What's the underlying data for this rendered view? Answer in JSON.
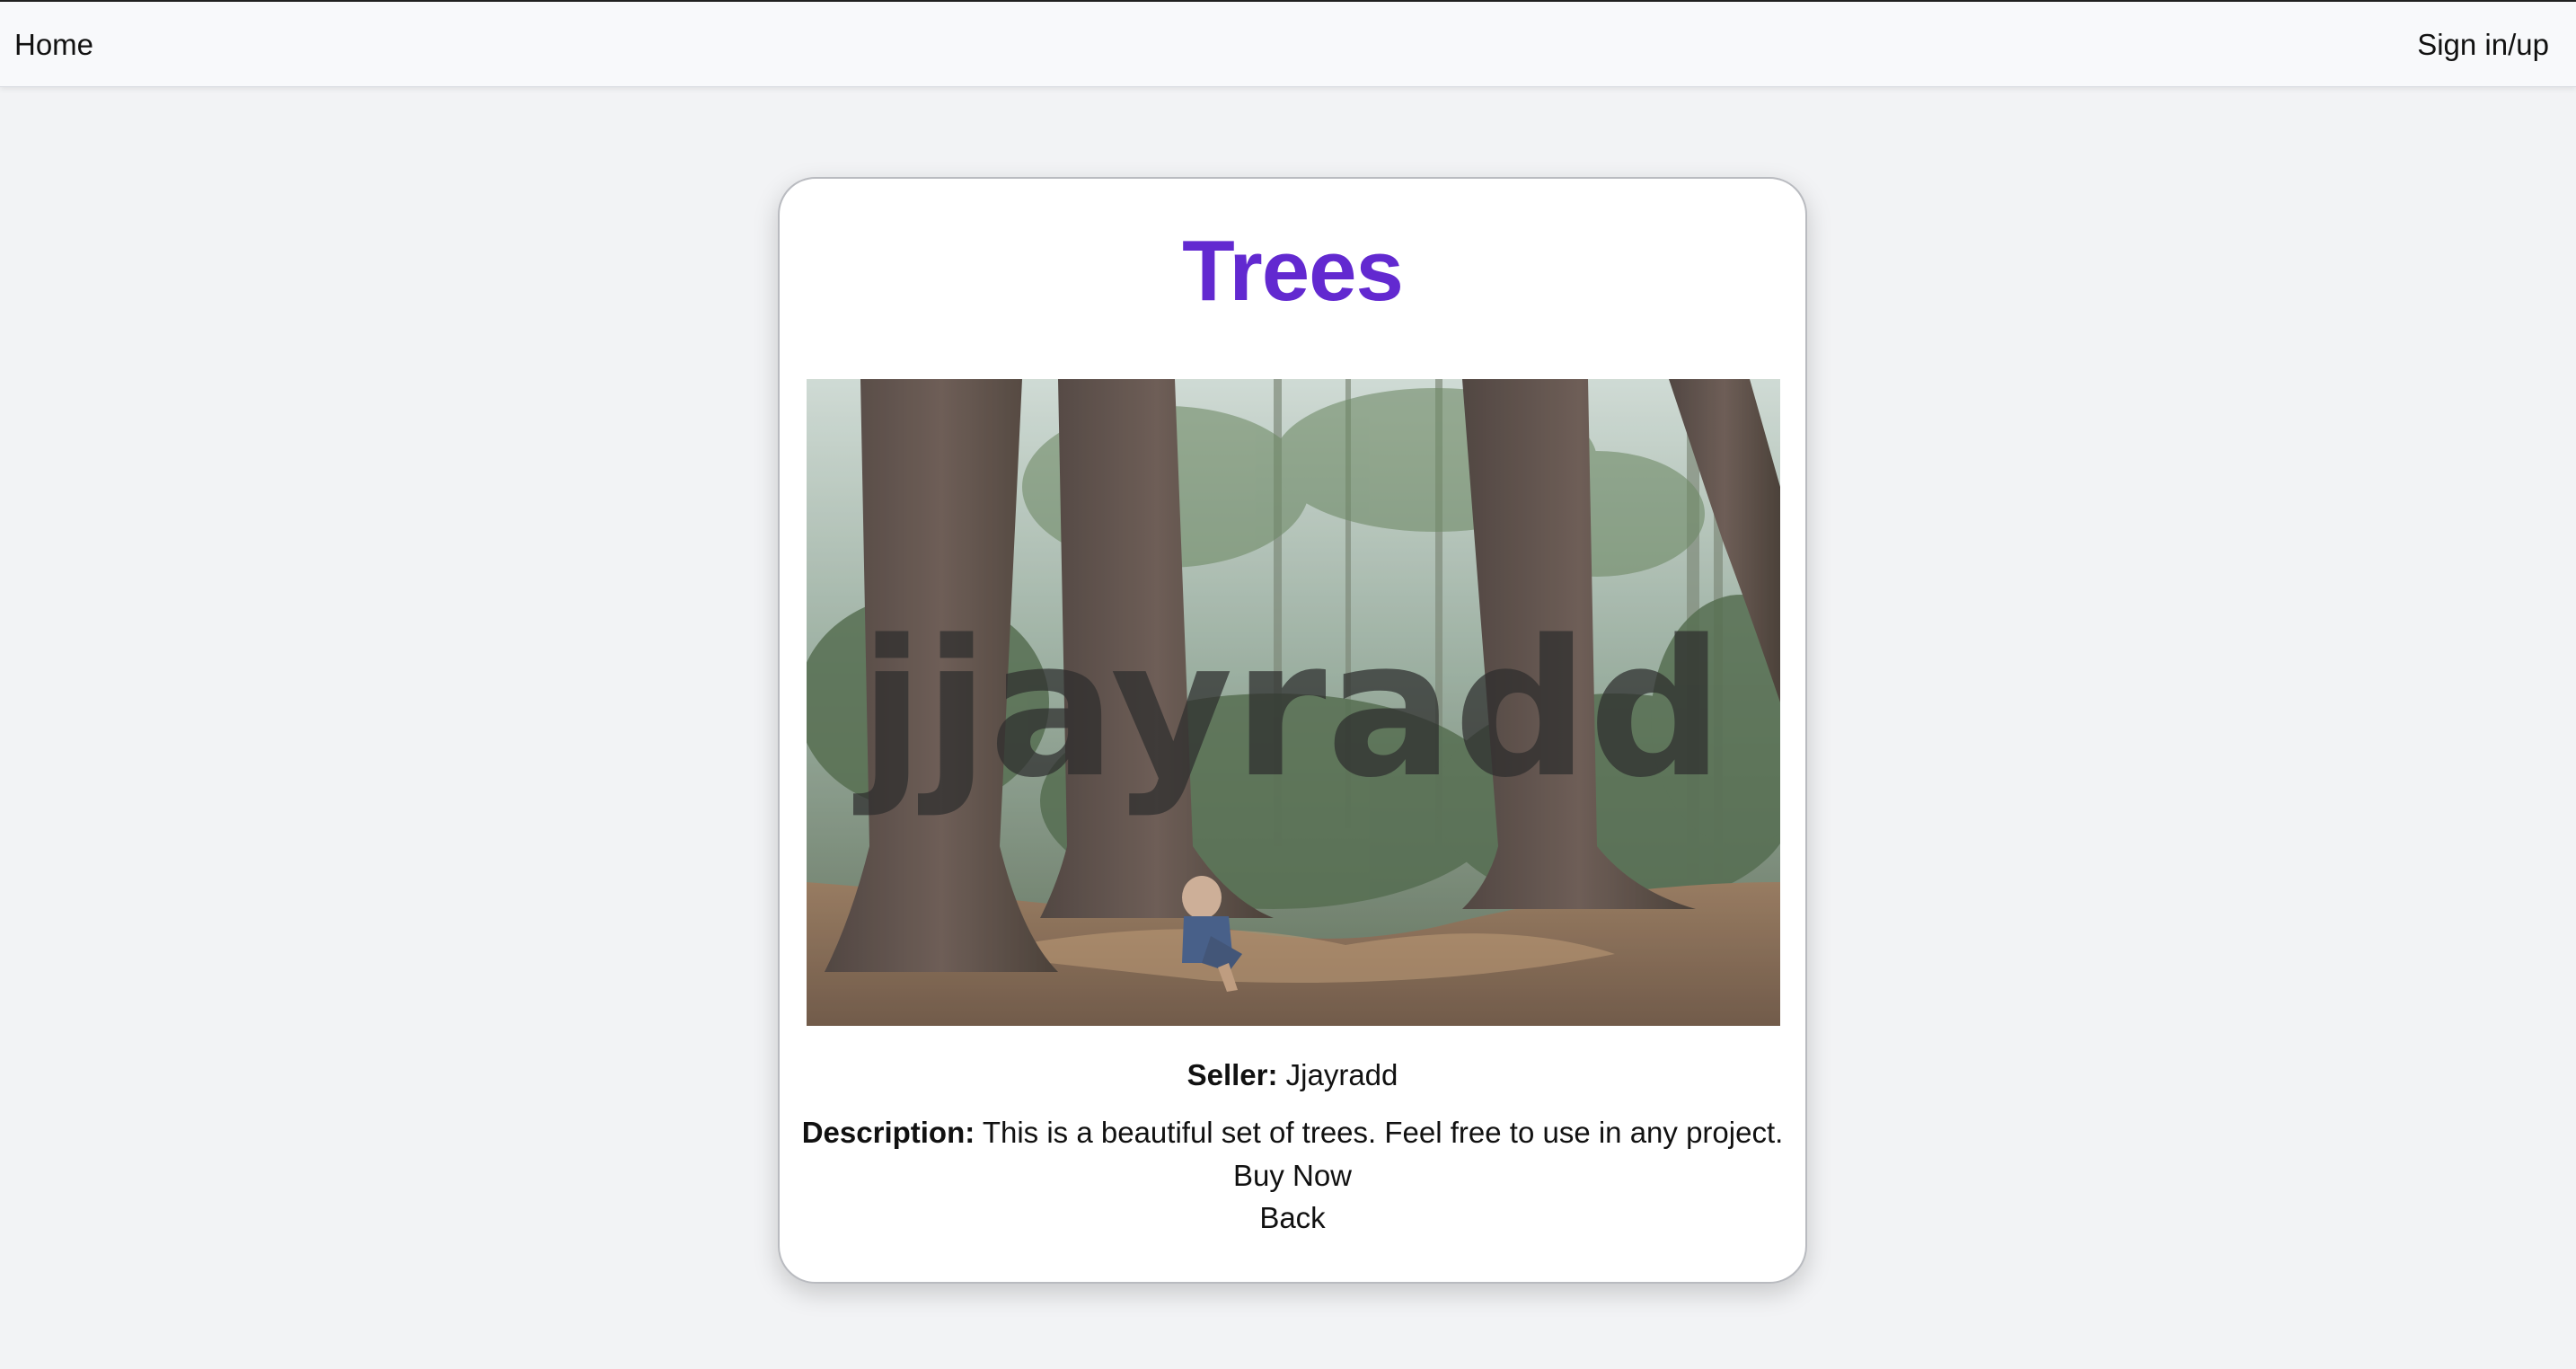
{
  "nav": {
    "home_label": "Home",
    "signin_label": "Sign in/up"
  },
  "product": {
    "title": "Trees",
    "image": {
      "icon": "forest-photo",
      "watermark": "jjayradd"
    },
    "seller_label": "Seller:",
    "seller_name": "Jjayradd",
    "description_label": "Description:",
    "description_text": "This is a beautiful set of trees. Feel free to use in any project."
  },
  "actions": {
    "buy_label": "Buy Now",
    "back_label": "Back"
  },
  "colors": {
    "title": "#6229d0",
    "page_background": "#f2f3f5",
    "card_background": "#ffffff"
  }
}
